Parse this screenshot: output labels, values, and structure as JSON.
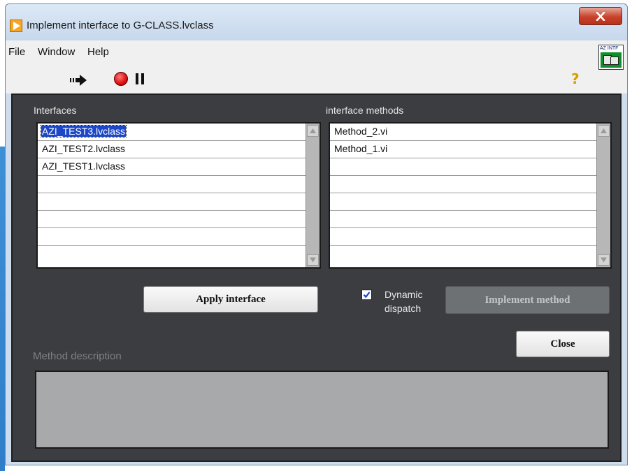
{
  "window": {
    "title": "Implement interface to G-CLASS.lvclass"
  },
  "menu": {
    "items": [
      "File",
      "Window",
      "Help"
    ]
  },
  "toolbar": {
    "run_icon": "run-arrow-icon",
    "stop_icon": "abort-icon",
    "pause_icon": "pause-icon",
    "help_icon": "help-icon",
    "vi_icon_label": "AZ INTF"
  },
  "interfaces": {
    "label": "Interfaces",
    "items": [
      "AZI_TEST3.lvclass",
      "AZI_TEST2.lvclass",
      "AZI_TEST1.lvclass"
    ],
    "selected_index": 0
  },
  "methods": {
    "label": "interface methods",
    "items": [
      "Method_2.vi",
      "Method_1.vi"
    ]
  },
  "buttons": {
    "apply": "Apply interface",
    "implement": "Implement method",
    "close": "Close"
  },
  "dynamic_dispatch": {
    "label_line1": "Dynamic",
    "label_line2": "dispatch",
    "checked": true
  },
  "description": {
    "label": "Method description",
    "value": ""
  },
  "colors": {
    "panel_bg": "#3b3d40",
    "selection": "#1c47c8",
    "desc_bg": "#a8a9ab"
  }
}
